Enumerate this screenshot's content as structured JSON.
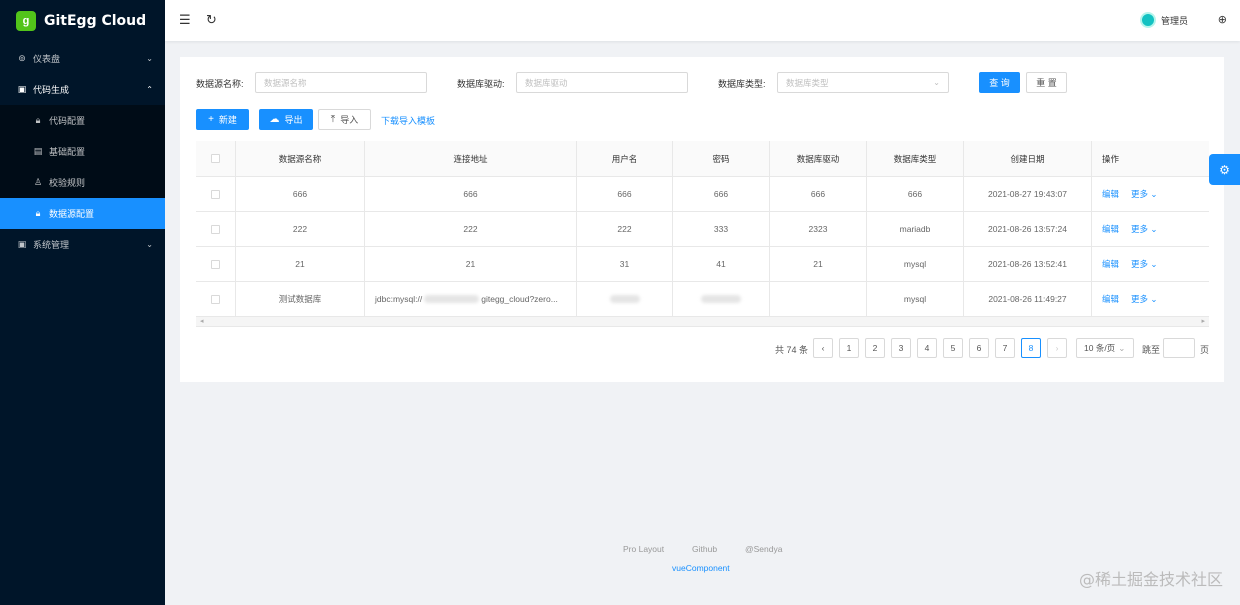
{
  "app": {
    "title": "GitEgg Cloud",
    "logo_letter": "g"
  },
  "sidebar": {
    "items": [
      {
        "label": "仪表盘",
        "icon": "dashboard-icon"
      },
      {
        "label": "代码生成",
        "icon": "code-icon"
      },
      {
        "label": "代码配置",
        "icon": "lock-icon"
      },
      {
        "label": "基础配置",
        "icon": "file-icon"
      },
      {
        "label": "校验规则",
        "icon": "user-check-icon"
      },
      {
        "label": "数据源配置",
        "icon": "lock-icon"
      },
      {
        "label": "系统管理",
        "icon": "settings-icon"
      }
    ]
  },
  "header": {
    "user_name": "管理员"
  },
  "search": {
    "ds_name_label": "数据源名称:",
    "ds_name_placeholder": "数据源名称",
    "driver_label": "数据库驱动:",
    "driver_placeholder": "数据库驱动",
    "db_type_label": "数据库类型:",
    "db_type_placeholder": "数据库类型",
    "query_label": "查 询",
    "reset_label": "重 置"
  },
  "toolbar": {
    "new_label": "新建",
    "export_label": "导出",
    "import_label": "导入",
    "download_template_label": "下载导入模板"
  },
  "table": {
    "columns": [
      "数据源名称",
      "连接地址",
      "用户名",
      "密码",
      "数据库驱动",
      "数据库类型",
      "创建日期",
      "操作"
    ],
    "rows": [
      {
        "name": "666",
        "url": "666",
        "user": "666",
        "password": "666",
        "driver": "666",
        "type": "666",
        "created": "2021-08-27 19:43:07"
      },
      {
        "name": "222",
        "url": "222",
        "user": "222",
        "password": "333",
        "driver": "2323",
        "type": "mariadb",
        "created": "2021-08-26 13:57:24"
      },
      {
        "name": "21",
        "url": "21",
        "user": "31",
        "password": "41",
        "driver": "21",
        "type": "mysql",
        "created": "2021-08-26 13:52:41"
      },
      {
        "name": "测试数据库",
        "url_prefix": "jdbc:mysql://",
        "url_suffix": "gitegg_cloud?zero...",
        "user": "",
        "password": "",
        "driver": "",
        "type": "mysql",
        "created": "2021-08-26 11:49:27"
      }
    ],
    "edit_label": "编辑",
    "more_label": "更多"
  },
  "pagination": {
    "total": "共 74 条",
    "pages": [
      "1",
      "2",
      "3",
      "4",
      "5",
      "6",
      "7",
      "8"
    ],
    "current": "8",
    "page_size": "10 条/页",
    "jump_label": "跳至",
    "page_suffix": "页"
  },
  "footer": {
    "links": [
      "Pro Layout",
      "Github",
      "@Sendya"
    ],
    "vue": "vueComponent"
  },
  "watermark": "@稀土掘金技术社区"
}
